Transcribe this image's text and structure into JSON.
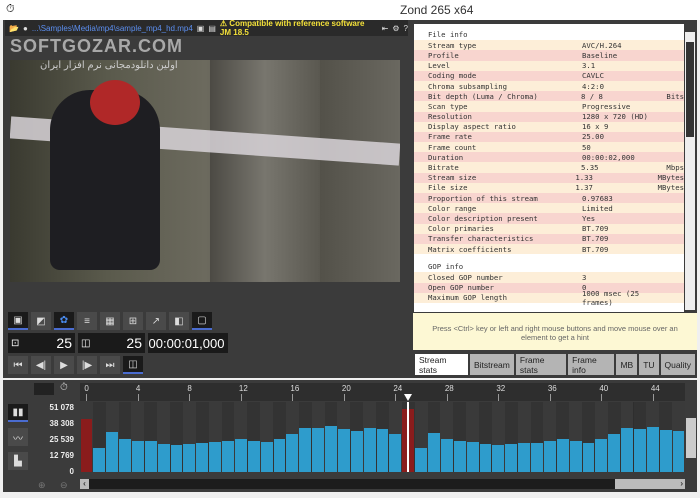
{
  "window": {
    "title": "Zond 265 x64"
  },
  "toolbar": {
    "path": "...\\Samples\\Media\\mp4\\sample_mp4_hd.mp4",
    "compat": "⚠ Compatible with reference software JM 18.5"
  },
  "watermark": {
    "brand": "SOFTGOZAR.COM",
    "sub": "اولین دانلودمجانی نرم افزار ایران"
  },
  "controls": {
    "frame_num": "25",
    "frame_num2": "25",
    "timecode": "00:00:01,000"
  },
  "info": {
    "section1": "File info",
    "rows": [
      [
        "Stream type",
        "AVC/H.264",
        ""
      ],
      [
        "Profile",
        "Baseline",
        ""
      ],
      [
        "Level",
        "3.1",
        ""
      ],
      [
        "Coding mode",
        "CAVLC",
        ""
      ],
      [
        "Chroma subsampling",
        "4:2:0",
        ""
      ],
      [
        "Bit depth (Luma / Chroma)",
        "8 / 8",
        "Bits"
      ],
      [
        "Scan type",
        "Progressive",
        ""
      ],
      [
        "Resolution",
        "1280 x 720 (HD)",
        ""
      ],
      [
        "Display aspect ratio",
        "16 x 9",
        ""
      ],
      [
        "Frame rate",
        "25.00",
        ""
      ],
      [
        "Frame count",
        "50",
        ""
      ],
      [
        "Duration",
        "00:00:02,000",
        ""
      ],
      [
        "Bitrate",
        "5.35",
        "Mbps"
      ],
      [
        "Stream size",
        "1.33",
        "MBytes"
      ],
      [
        "File size",
        "1.37",
        "MBytes"
      ],
      [
        "Proportion of this stream",
        "0.97683",
        ""
      ],
      [
        "Color range",
        "Limited",
        ""
      ],
      [
        "Color description present",
        "Yes",
        ""
      ],
      [
        "Color primaries",
        "BT.709",
        ""
      ],
      [
        "Transfer characteristics",
        "BT.709",
        ""
      ],
      [
        "Matrix coefficients",
        "BT.709",
        ""
      ]
    ],
    "section2": "GOP info",
    "gop_rows": [
      [
        "Closed GOP number",
        "3",
        ""
      ],
      [
        "Open GOP number",
        "0",
        ""
      ],
      [
        "Maximum GOP length",
        "1000 msec (25 frames)",
        ""
      ]
    ]
  },
  "hint": "Press <Ctrl> key or left and right mouse buttons and move mouse over an element to get a hint",
  "tabs": [
    "Stream stats",
    "Bitstream",
    "Frame stats",
    "Frame info",
    "MB",
    "TU",
    "Quality"
  ],
  "chart_data": {
    "type": "bar",
    "x_ticks": [
      "0",
      "4",
      "8",
      "12",
      "16",
      "20",
      "24",
      "28",
      "32",
      "36",
      "40",
      "44"
    ],
    "y_ticks": [
      "51 078",
      "38 308",
      "25 539",
      "12 769",
      "0"
    ],
    "ylim": [
      0,
      51078
    ],
    "current_frame": 25,
    "intra_frames": [
      0,
      25
    ],
    "values": [
      42400,
      19000,
      32000,
      26000,
      25000,
      25000,
      22000,
      21500,
      22500,
      23500,
      24000,
      24500,
      26000,
      25000,
      24000,
      26500,
      30000,
      35500,
      35000,
      36500,
      34000,
      33000,
      35500,
      34500,
      30000,
      50000,
      19000,
      31500,
      26000,
      25000,
      24000,
      22000,
      21500,
      22500,
      23500,
      23500,
      24500,
      26000,
      25000,
      23500,
      26500,
      30000,
      35500,
      34500,
      36000,
      33500,
      33000
    ],
    "colors": {
      "p": "#2e9ccc",
      "i": "#8a1c1c"
    }
  }
}
